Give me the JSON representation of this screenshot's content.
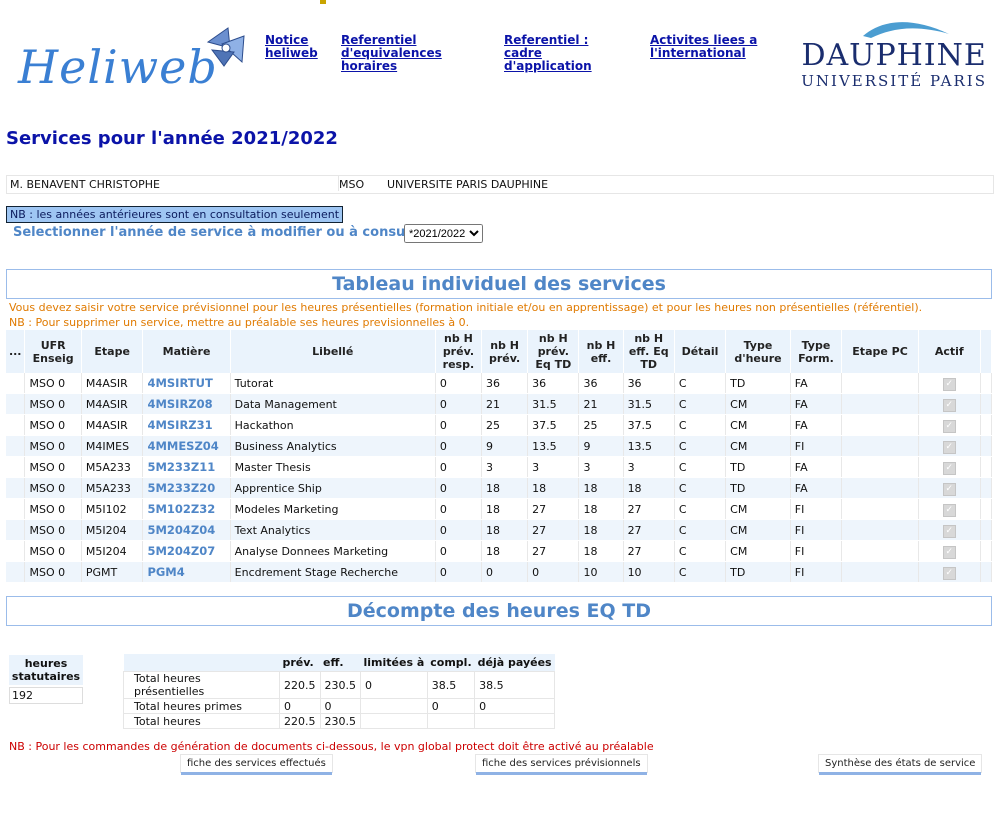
{
  "header": {
    "logo": "Heliweb",
    "links": [
      {
        "label": "Notice heliweb"
      },
      {
        "label": "Referentiel d'equivalences horaires"
      },
      {
        "label": "Referentiel : cadre d'application"
      },
      {
        "label": "Activites liees a l'international"
      }
    ],
    "university_big": "DAUPHINE",
    "university_small": "UNIVERSITÉ PARIS"
  },
  "page_title": "Services pour l'année 2021/2022",
  "identity": {
    "name": "M. BENAVENT CHRISTOPHE",
    "code": "MSO",
    "institution": "UNIVERSITE PARIS DAUPHINE"
  },
  "nb_note": "NB : les années antérieures sont en consultation seulement",
  "select_label": "Selectionner l'année de service à modifier ou à consulter",
  "select_value": "*2021/2022",
  "section1_title": "Tableau individuel des services",
  "warning1": "Vous devez saisir votre service prévisionnel pour les heures présentielles (formation initiale et/ou en apprentissage) et pour les heures non présentielles (référentiel).",
  "warning2": "NB : Pour supprimer un service, mettre au préalable ses heures previsionnelles à 0.",
  "table": {
    "headers": [
      "...",
      "UFR Enseig",
      "Etape",
      "Matière",
      "Libellé",
      "nb H prév. resp.",
      "nb H prév.",
      "nb H prév. Eq TD",
      "nb H eff.",
      "nb H eff. Eq TD",
      "Détail",
      "Type d'heure",
      "Type Form.",
      "Etape PC",
      "Actif"
    ],
    "rows": [
      [
        "MSO 0",
        "M4ASIR",
        "4MSIRTUT",
        "Tutorat",
        "0",
        "36",
        "36",
        "36",
        "36",
        "C",
        "TD",
        "FA",
        ""
      ],
      [
        "MSO 0",
        "M4ASIR",
        "4MSIRZ08",
        "Data Management",
        "0",
        "21",
        "31.5",
        "21",
        "31.5",
        "C",
        "CM",
        "FA",
        ""
      ],
      [
        "MSO 0",
        "M4ASIR",
        "4MSIRZ31",
        "Hackathon",
        "0",
        "25",
        "37.5",
        "25",
        "37.5",
        "C",
        "CM",
        "FA",
        ""
      ],
      [
        "MSO 0",
        "M4IMES",
        "4MMESZ04",
        "Business Analytics",
        "0",
        "9",
        "13.5",
        "9",
        "13.5",
        "C",
        "CM",
        "FI",
        ""
      ],
      [
        "MSO 0",
        "M5A233",
        "5M233Z11",
        "Master Thesis",
        "0",
        "3",
        "3",
        "3",
        "3",
        "C",
        "TD",
        "FA",
        ""
      ],
      [
        "MSO 0",
        "M5A233",
        "5M233Z20",
        "Apprentice Ship",
        "0",
        "18",
        "18",
        "18",
        "18",
        "C",
        "TD",
        "FA",
        ""
      ],
      [
        "MSO 0",
        "M5I102",
        "5M102Z32",
        "Modeles Marketing",
        "0",
        "18",
        "27",
        "18",
        "27",
        "C",
        "CM",
        "FI",
        ""
      ],
      [
        "MSO 0",
        "M5I204",
        "5M204Z04",
        "Text Analytics",
        "0",
        "18",
        "27",
        "18",
        "27",
        "C",
        "CM",
        "FI",
        ""
      ],
      [
        "MSO 0",
        "M5I204",
        "5M204Z07",
        "Analyse Donnees Marketing",
        "0",
        "18",
        "27",
        "18",
        "27",
        "C",
        "CM",
        "FI",
        ""
      ],
      [
        "MSO 0",
        "PGMT",
        "PGM4",
        "Encdrement Stage Recherche",
        "0",
        "0",
        "0",
        "10",
        "10",
        "C",
        "TD",
        "FI",
        ""
      ]
    ]
  },
  "section2_title": "Décompte des heures EQ TD",
  "statutory": {
    "label": "heures statutaires",
    "value": "192"
  },
  "totals": {
    "headers": [
      "",
      "prév.",
      "eff.",
      "limitées à",
      "compl.",
      "déjà payées"
    ],
    "rows": [
      [
        "Total heures présentielles",
        "220.5",
        "230.5",
        "0",
        "38.5",
        "38.5"
      ],
      [
        "Total heures primes",
        "0",
        "0",
        "",
        "0",
        "0"
      ],
      [
        "Total heures",
        "220.5",
        "230.5",
        "",
        "",
        ""
      ]
    ]
  },
  "vpn_note": "NB : Pour les commandes de génération de documents ci-dessous, le vpn global protect doit être activé au préalable",
  "buttons": {
    "done": "fiche des services effectués",
    "planned": "fiche des services prévisionnels",
    "summary": "Synthèse des états de service"
  }
}
